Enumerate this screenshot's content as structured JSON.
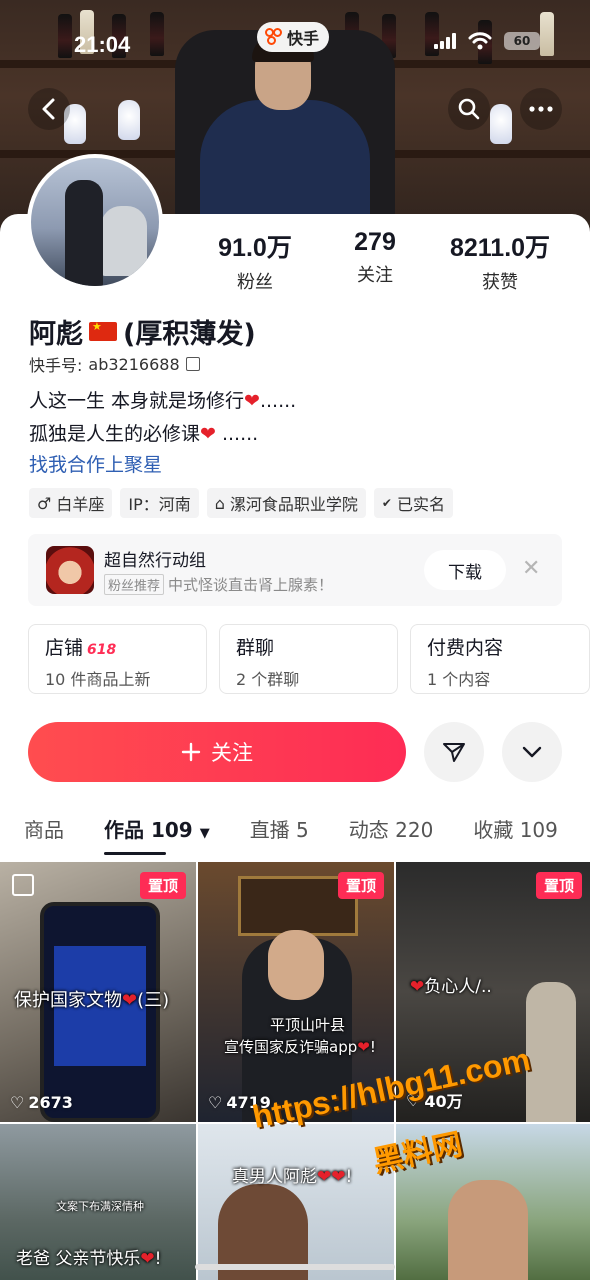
{
  "status_bar": {
    "time": "21:04",
    "battery": "60",
    "app_badge": "快手"
  },
  "header": {
    "back_icon": "chevron-left-icon",
    "search_icon": "search-icon",
    "more_icon": "more-icon"
  },
  "profile": {
    "name": "阿彪",
    "name_suffix": "(厚积薄发)",
    "flag_icon": "china-flag-icon",
    "uid_label": "快手号:",
    "uid": "ab3216688",
    "stats": [
      {
        "value": "91.0万",
        "label": "粉丝"
      },
      {
        "value": "279",
        "label": "关注"
      },
      {
        "value": "8211.0万",
        "label": "获赞"
      }
    ],
    "bio_line1": "人这一生 本身就是场修行",
    "bio_line1_tail": "......",
    "bio_line2": "孤独是人生的必修课",
    "bio_line2_tail": " ......",
    "collab_link": "找我合作上聚星",
    "tags": [
      {
        "icon": "male-icon",
        "glyph": "♂",
        "label": "白羊座"
      },
      {
        "icon": "",
        "glyph": "",
        "label": "IP：河南"
      },
      {
        "icon": "school-icon",
        "glyph": "⌂",
        "label": "漯河食品职业学院"
      },
      {
        "icon": "verified-shield-icon",
        "glyph": "✔",
        "label": "已实名"
      }
    ]
  },
  "promo": {
    "title": "超自然行动组",
    "badge": "粉丝推荐",
    "subtitle": "中式怪谈直击肾上腺素！",
    "download_label": "下载"
  },
  "entries": [
    {
      "title": "店铺",
      "badge": "618",
      "subtitle": "10 件商品上新"
    },
    {
      "title": "群聊",
      "badge": "",
      "subtitle": "2 个群聊"
    },
    {
      "title": "付费内容",
      "badge": "",
      "subtitle": "1 个内容"
    }
  ],
  "actions": {
    "follow_label": "关注",
    "follow_icon": "plus-icon",
    "share_icon": "send-icon",
    "expand_icon": "chevron-down-icon"
  },
  "tabs": [
    {
      "label": "商品",
      "count": ""
    },
    {
      "label": "作品",
      "count": "109"
    },
    {
      "label": "直播",
      "count": "5"
    },
    {
      "label": "动态",
      "count": "220"
    },
    {
      "label": "收藏",
      "count": "109"
    }
  ],
  "videos": [
    {
      "pinned": "置顶",
      "caption": "保护国家文物",
      "caption_tail": "(三)",
      "likes": "2673"
    },
    {
      "pinned": "置顶",
      "caption": "平顶山叶县",
      "caption2": "宣传国家反诈骗app",
      "likes": "4719"
    },
    {
      "pinned": "置顶",
      "caption": "负心人/..",
      "likes": "40万"
    },
    {
      "caption_small": "文案下布满深情种",
      "caption": "老爸 父亲节快乐",
      "likes": ""
    },
    {
      "caption": "真男人阿彪",
      "likes": ""
    },
    {
      "caption": "",
      "likes": ""
    }
  ],
  "watermark": {
    "url": "https://hlbg11.com",
    "name": "黑料网"
  },
  "colors": {
    "accent": "#fe2c55",
    "link": "#2f5fb3",
    "watermark": "#ff9900"
  }
}
